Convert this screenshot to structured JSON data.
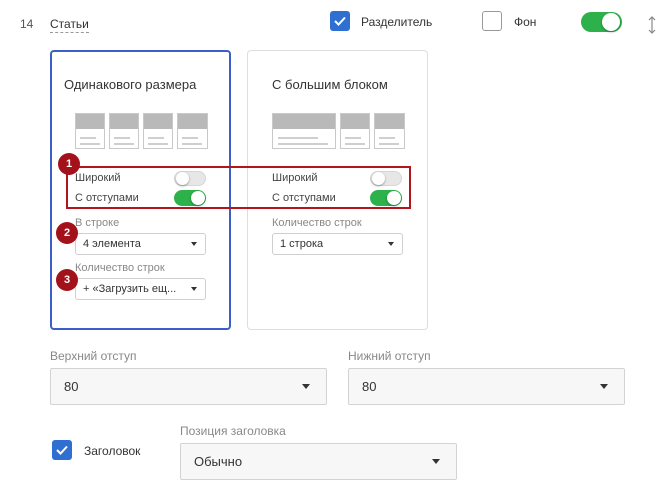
{
  "header": {
    "row_number": "14",
    "row_title": "Статьи",
    "separator_checkbox": {
      "label": "Разделитель",
      "checked": true
    },
    "background_checkbox": {
      "label": "Фон",
      "checked": false
    },
    "main_toggle_on": true,
    "drag_icon": "vertical-resize-icon"
  },
  "cards": [
    {
      "title": "Одинакового размера",
      "selected": true,
      "layout_icon": "equal-size-grid",
      "wide_label": "Широкий",
      "wide_on": false,
      "padding_label": "С отступами",
      "padding_on": true,
      "per_row_label": "В строке",
      "per_row_value": "4 элемента",
      "rows_label": "Количество строк",
      "rows_value": "+ «Загрузить ещ..."
    },
    {
      "title": "С большим блоком",
      "selected": false,
      "layout_icon": "large-block-grid",
      "wide_label": "Широкий",
      "wide_on": false,
      "padding_label": "С отступами",
      "padding_on": true,
      "rows_label": "Количество строк",
      "rows_value": "1 строка"
    }
  ],
  "callouts": [
    "1",
    "2",
    "3"
  ],
  "callout_color": "#a3111b",
  "accent_color": "#2f6fd1",
  "toggle_on_color": "#2db14a",
  "margins": {
    "top_label": "Верхний отступ",
    "top_value": "80",
    "bottom_label": "Нижний отступ",
    "bottom_value": "80"
  },
  "heading": {
    "checkbox_label": "Заголовок",
    "checked": true,
    "position_label": "Позиция заголовка",
    "position_value": "Обычно"
  }
}
